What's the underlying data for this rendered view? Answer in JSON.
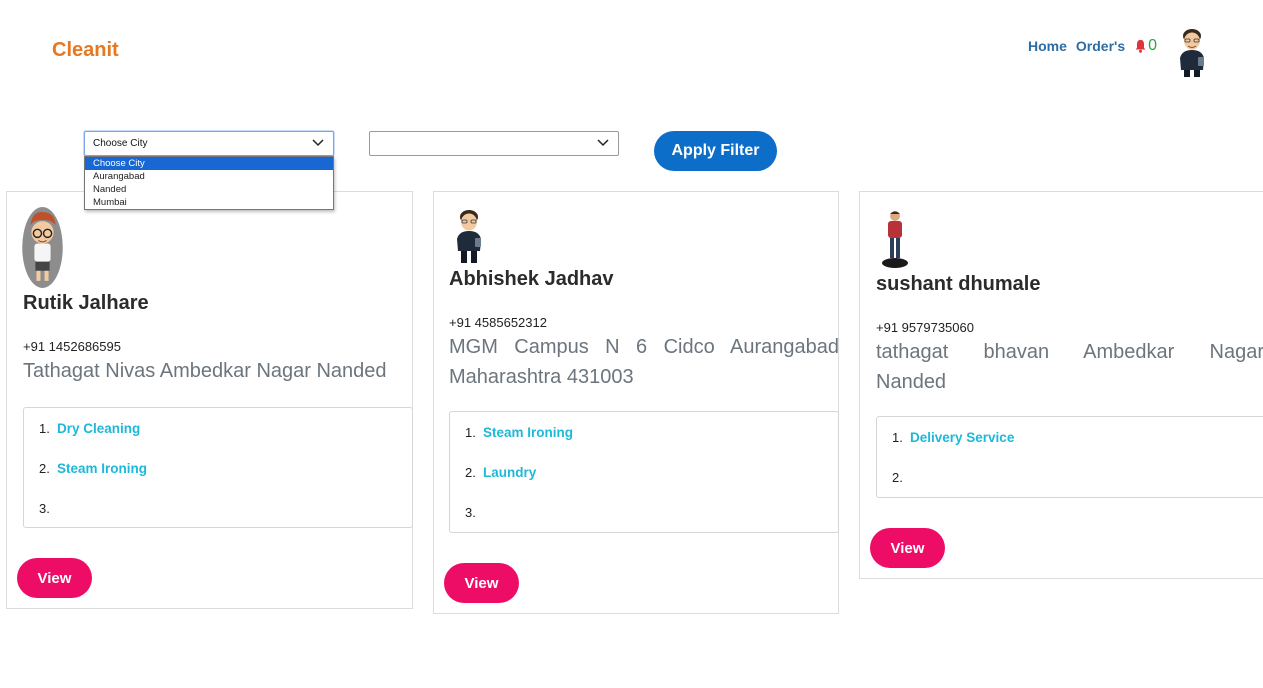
{
  "navbar": {
    "brand": "Cleanit",
    "links": [
      "Home",
      "Order's"
    ],
    "notification_count": "0",
    "avatar_icon": "user-avatar-icon"
  },
  "filters": {
    "city_select_value": "Choose City",
    "city_options": [
      "Choose City",
      "Aurangabad",
      "Nanded",
      "Mumbai"
    ],
    "area_select_value": "",
    "apply_label": "Apply Filter"
  },
  "cards": [
    {
      "name": "Rutik Jalhare",
      "phone": "+91 1452686595",
      "address": "Tathagat Nivas Ambedkar Nagar Nanded",
      "services": [
        {
          "num": "1.",
          "label": "Dry Cleaning"
        },
        {
          "num": "2.",
          "label": "Steam Ironing"
        },
        {
          "num": "3.",
          "label": ""
        }
      ],
      "view_label": "View"
    },
    {
      "name": "Abhishek Jadhav",
      "phone": "+91 4585652312",
      "address": "MGM Campus N 6 Cidco Aurangabad Maharashtra 431003",
      "services": [
        {
          "num": "1.",
          "label": "Steam Ironing"
        },
        {
          "num": "2.",
          "label": "Laundry"
        },
        {
          "num": "3.",
          "label": ""
        }
      ],
      "view_label": "View"
    },
    {
      "name": "sushant dhumale",
      "phone": "+91 9579735060",
      "address": "tathagat bhavan Ambedkar Nagar Nanded",
      "services": [
        {
          "num": "1.",
          "label": "Delivery Service"
        },
        {
          "num": "2.",
          "label": ""
        }
      ],
      "view_label": "View"
    }
  ],
  "colors": {
    "brand": "#e87722",
    "nav_link": "#2e6da4",
    "apply_button": "#0d6ec9",
    "view_button": "#ee0d66",
    "service_link": "#1fb8d8",
    "bell": "#e0343c",
    "count": "#28a745"
  }
}
